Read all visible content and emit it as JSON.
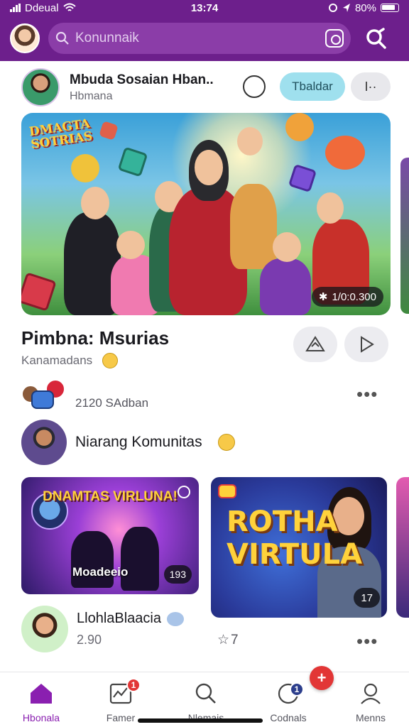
{
  "status_bar": {
    "carrier": "Ddeual",
    "time": "13:74",
    "battery": "80%"
  },
  "header": {
    "search_placeholder": "Konunnaik"
  },
  "post": {
    "author": "Mbuda Sosaian Hban..",
    "subtitle": "Hbmana",
    "follow_label": "Tbaldar",
    "more_label": "I··",
    "duration": "1/0:0.300",
    "video_title": "Pimbna: Msurias",
    "video_subtitle": "Kanamadans",
    "reaction_count": "2120 SAdban"
  },
  "community": {
    "name": "Niarang Komunitas"
  },
  "cards": [
    {
      "title": "DNAMTAS VIRLUNA!",
      "caption": "Moadeeio",
      "badge": "193"
    },
    {
      "title": "ROTHA VIRTULA",
      "badge": "17"
    }
  ],
  "commenter": {
    "name": "LlohlaBlaacia",
    "subtitle": "2.90",
    "stars": "7"
  },
  "nav": {
    "items": [
      {
        "label": "Hbonala",
        "icon": "home-icon",
        "active": true
      },
      {
        "label": "Famer",
        "icon": "chart-icon",
        "badge": "1"
      },
      {
        "label": "Nlemais",
        "icon": "search-icon"
      },
      {
        "label": "Codnals",
        "icon": "chat-icon",
        "badge": "1"
      },
      {
        "label": "Menns",
        "icon": "profile-icon"
      }
    ],
    "fab_label": "+"
  },
  "colors": {
    "brand": "#6d1f8c",
    "accent": "#8a1fb0",
    "follow_bg": "#9fe0ee",
    "badge": "#e23636"
  }
}
